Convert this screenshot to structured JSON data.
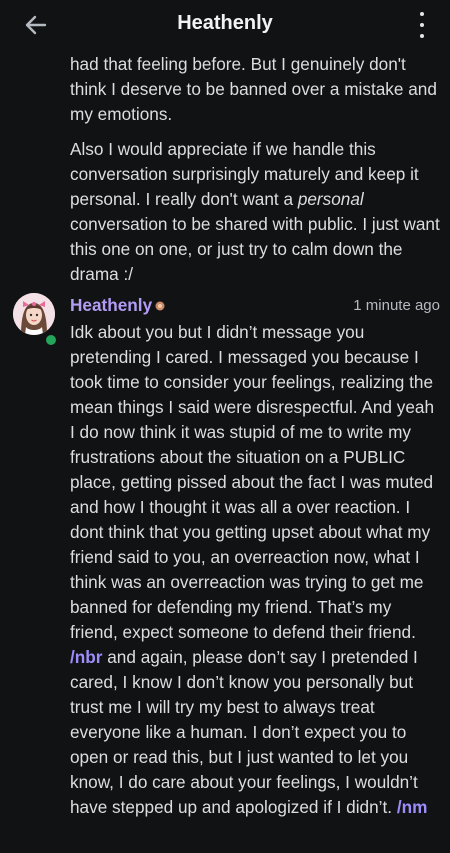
{
  "header": {
    "title": "Heathenly"
  },
  "messages": {
    "previous": {
      "paragraph1": "had that feeling before. But I genuinely don't think I deserve to be banned over a mistake and my emotions.",
      "paragraph2_a": "Also I would appreciate if we handle this conversation surprisingly maturely and keep it personal. I really don't want a ",
      "paragraph2_em": "personal",
      "paragraph2_b": " conversation to be shared with public. I just want this one on one, or just try to calm down the drama :/"
    },
    "current": {
      "author": "Heathenly",
      "timestamp": "1 minute ago",
      "text_a": "Idk about you but I didn’t message you pretending I cared. I messaged you because I took time to consider your feelings, realizing the mean things I said were disrespectful. And yeah I do now think it was stupid of me to write my frustrations about the situation on a PUBLIC place, getting pissed about the fact I was muted and how I thought it was all a over reaction. I dont think that you getting upset about what my friend said to you,  an overreaction now, what I think was an overreaction was trying to get me banned for defending my friend. That’s my friend, expect someone to defend their friend. ",
      "tag1": "/nbr",
      "text_b": " and again, please don’t say I pretended I cared, I know I don’t know you personally but trust me I will try my best to always treat everyone like a human. I don’t expect you to open or read this, but I just wanted to let you know, I do care about your feelings, I wouldn’t have stepped up and apologized if I didn’t. ",
      "tag2": "/nm"
    }
  },
  "colors": {
    "background": "#111214",
    "author": "#b39cf4",
    "tone_tag": "#9e8cfa",
    "online": "#23a55a"
  },
  "icons": {
    "back": "arrow-left-icon",
    "more": "more-vertical-icon",
    "badge": "role-badge-icon"
  }
}
